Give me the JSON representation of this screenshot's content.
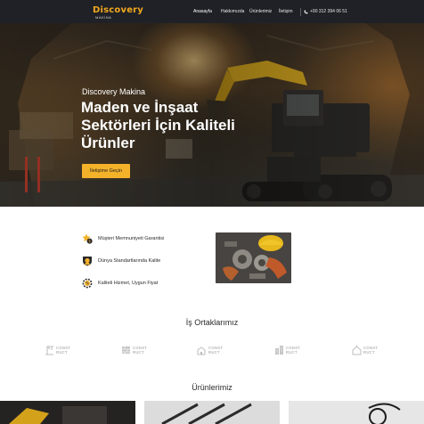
{
  "nav": {
    "logo": "Discovery",
    "logo_sub": "MAKİNA",
    "menu": [
      {
        "label": "Anasayfa"
      },
      {
        "label": "Hakkımızda"
      },
      {
        "label": "Ürünlerimiz"
      },
      {
        "label": "İletişim"
      }
    ],
    "phone": "+90 312 394 06 51"
  },
  "hero": {
    "kicker": "Discovery Makina",
    "title": "Maden ve İnşaat Sektörleri İçin Kaliteli Ürünler",
    "button": "İletişime Geçin"
  },
  "features": [
    {
      "label": "Müşteri Memnuniyeti Garantisi",
      "icon": "star-coin-icon"
    },
    {
      "label": "Dünya Standartlarında Kalite",
      "icon": "medal-badge-icon"
    },
    {
      "label": "Kaliteli Hizmet, Uygun Fiyat",
      "icon": "gear-percent-icon"
    }
  ],
  "partners": {
    "title": "İş Ortaklarımız",
    "items": [
      {
        "line1": "CONST",
        "line2": "RUCT"
      },
      {
        "line1": "CONST",
        "line2": "RUCT"
      },
      {
        "line1": "CONST",
        "line2": "RUCT"
      },
      {
        "line1": "CONST",
        "line2": "RUCT"
      },
      {
        "line1": "CONST",
        "line2": "RUCT"
      }
    ]
  },
  "products": {
    "title": "Ürünlerimiz"
  },
  "colors": {
    "accent": "#f4b22a",
    "nav_bg": "#1f2126",
    "text_dark": "#2a2a2a",
    "partner_gray": "#a9a9a9"
  }
}
